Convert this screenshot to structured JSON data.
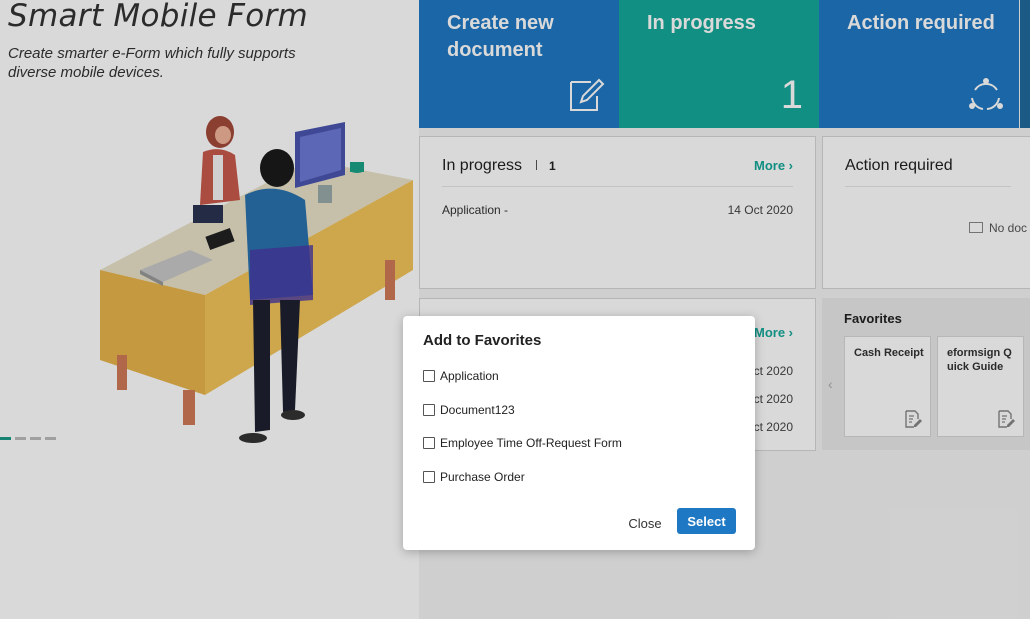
{
  "hero": {
    "title": "Smart Mobile Form",
    "subtitle": "Create smarter e-Form which fully supports diverse mobile devices."
  },
  "tiles": {
    "create": {
      "label": "Create new document",
      "icon": "edit-document-icon",
      "color": "#1f78c4"
    },
    "in_progress": {
      "label": "In progress",
      "count": "1",
      "color": "#16a99a"
    },
    "action_required": {
      "label": "Action required",
      "icon": "sync-icon",
      "color": "#1f78c4"
    }
  },
  "in_progress_panel": {
    "title": "In progress",
    "count": "1",
    "more": "More",
    "rows": [
      {
        "name": "Application -",
        "date": "14 Oct 2020"
      }
    ]
  },
  "action_panel": {
    "title": "Action required",
    "empty_text": "No doc"
  },
  "second_panel": {
    "more": "More",
    "dates": [
      "ct 2020",
      "ct 2020",
      "ct 2020"
    ]
  },
  "favorites": {
    "title": "Favorites",
    "cards": [
      {
        "label": "Cash Receipt",
        "icon": "document-edit-icon"
      },
      {
        "label": "eformsign Q uick Guide",
        "icon": "document-edit-icon"
      }
    ]
  },
  "modal": {
    "title": "Add to Favorites",
    "options": [
      {
        "label": "Application",
        "checked": false
      },
      {
        "label": "Document123",
        "checked": false
      },
      {
        "label": "Employee Time Off-Request Form",
        "checked": false
      },
      {
        "label": "Purchase Order",
        "checked": false
      }
    ],
    "close_label": "Close",
    "select_label": "Select",
    "accent": "#1f78c4"
  }
}
